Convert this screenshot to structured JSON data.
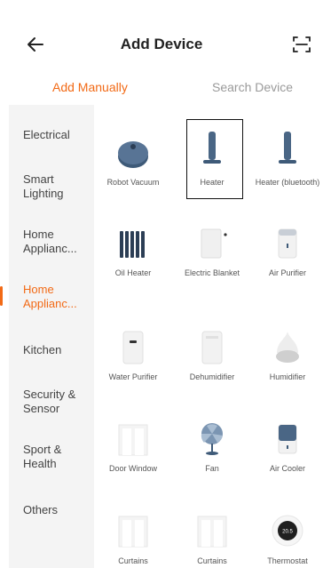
{
  "header": {
    "title": "Add Device"
  },
  "tabs": [
    {
      "label": "Add Manually"
    },
    {
      "label": "Search Device"
    }
  ],
  "categories": [
    {
      "label": "Electrical"
    },
    {
      "label": "Smart Lighting"
    },
    {
      "label": "Home Applianc..."
    },
    {
      "label": "Home Applianc..."
    },
    {
      "label": "Kitchen"
    },
    {
      "label": "Security & Sensor"
    },
    {
      "label": "Sport & Health"
    },
    {
      "label": "Others"
    }
  ],
  "devices": [
    {
      "label": "Robot Vacuum",
      "icon": "robot-vacuum-icon"
    },
    {
      "label": "Heater",
      "icon": "heater-icon"
    },
    {
      "label": "Heater (bluetooth)",
      "icon": "heater-icon"
    },
    {
      "label": "Oil Heater",
      "icon": "oil-heater-icon"
    },
    {
      "label": "Electric Blanket",
      "icon": "electric-blanket-icon"
    },
    {
      "label": "Air Purifier",
      "icon": "air-purifier-icon"
    },
    {
      "label": "Water Purifier",
      "icon": "water-purifier-icon"
    },
    {
      "label": "Dehumidifier",
      "icon": "dehumidifier-icon"
    },
    {
      "label": "Humidifier",
      "icon": "humidifier-icon"
    },
    {
      "label": "Door Window",
      "icon": "door-window-icon"
    },
    {
      "label": "Fan",
      "icon": "fan-icon"
    },
    {
      "label": "Air Cooler",
      "icon": "air-cooler-icon"
    },
    {
      "label": "Curtains",
      "icon": "curtains-icon"
    },
    {
      "label": "Curtains",
      "icon": "curtains-icon"
    },
    {
      "label": "Thermostat",
      "icon": "thermostat-icon",
      "display": "20.5"
    }
  ],
  "colors": {
    "accent": "#f26a16",
    "sidebar_bg": "#f4f4f4",
    "device_dark": "#3e5a78"
  }
}
